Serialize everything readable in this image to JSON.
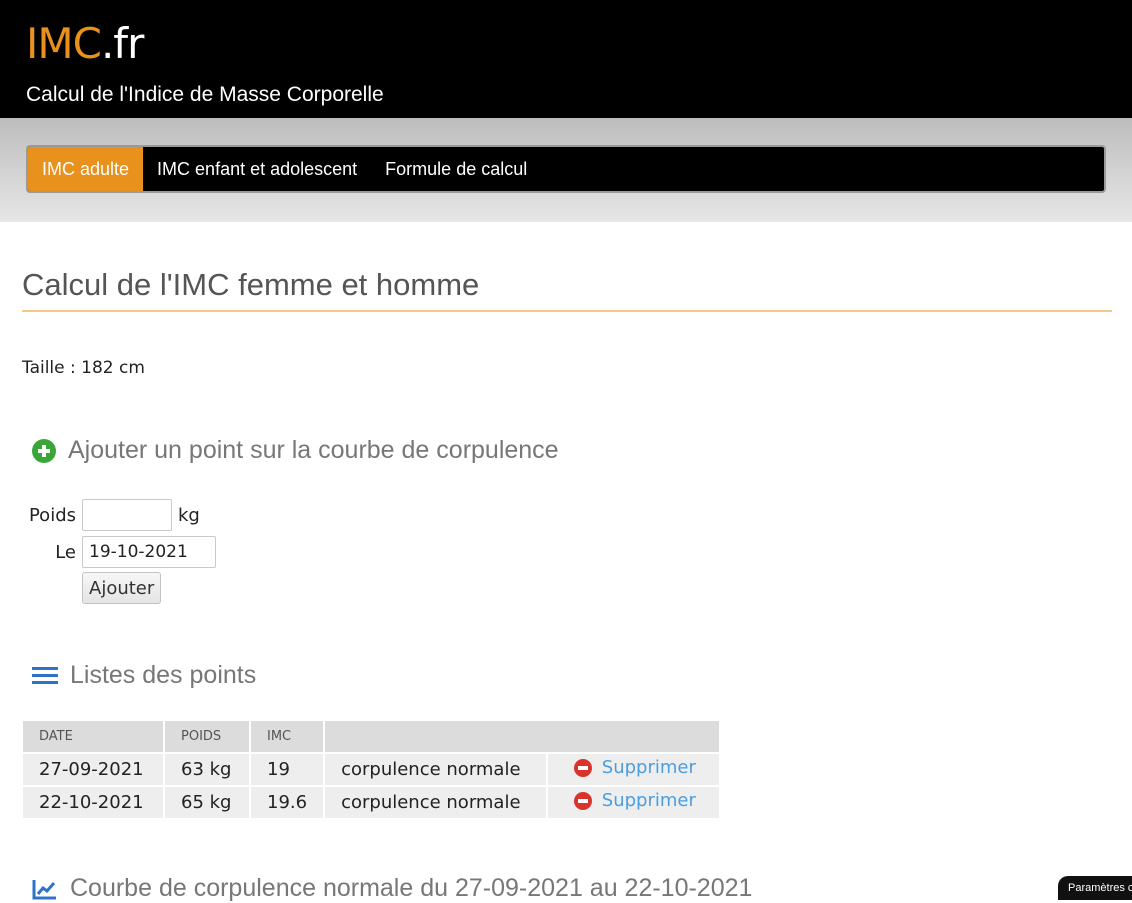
{
  "header": {
    "logo_main": "IMC",
    "logo_tld": ".fr",
    "tagline": "Calcul de l'Indice de Masse Corporelle"
  },
  "nav": {
    "items": [
      {
        "label": "IMC adulte",
        "active": true
      },
      {
        "label": "IMC enfant et adolescent",
        "active": false
      },
      {
        "label": "Formule de calcul",
        "active": false
      }
    ]
  },
  "main": {
    "title": "Calcul de l'IMC femme et homme",
    "taille": "Taille : 182 cm"
  },
  "add_section": {
    "heading": "Ajouter un point sur la courbe de corpulence",
    "icon": "plus-circle-icon",
    "poids_label": "Poids",
    "poids_value": "",
    "poids_unit": "kg",
    "date_label": "Le",
    "date_value": "19-10-2021",
    "submit_label": "Ajouter"
  },
  "list_section": {
    "heading": "Listes des points",
    "icon": "list-icon",
    "columns": [
      "DATE",
      "POIDS",
      "IMC",
      ""
    ],
    "rows": [
      {
        "date": "27-09-2021",
        "poids": "63 kg",
        "imc": "19",
        "status": "corpulence normale",
        "action": "Supprimer"
      },
      {
        "date": "22-10-2021",
        "poids": "65 kg",
        "imc": "19.6",
        "status": "corpulence normale",
        "action": "Supprimer"
      }
    ]
  },
  "chart_section": {
    "heading": "Courbe de corpulence normale du 27-09-2021 au 22-10-2021",
    "icon": "line-chart-icon"
  },
  "cookie": {
    "label": "Paramètres co"
  },
  "colors": {
    "accent": "#e8911c",
    "link": "#4a9de0",
    "delete": "#d9342b",
    "add": "#3aa63a"
  }
}
